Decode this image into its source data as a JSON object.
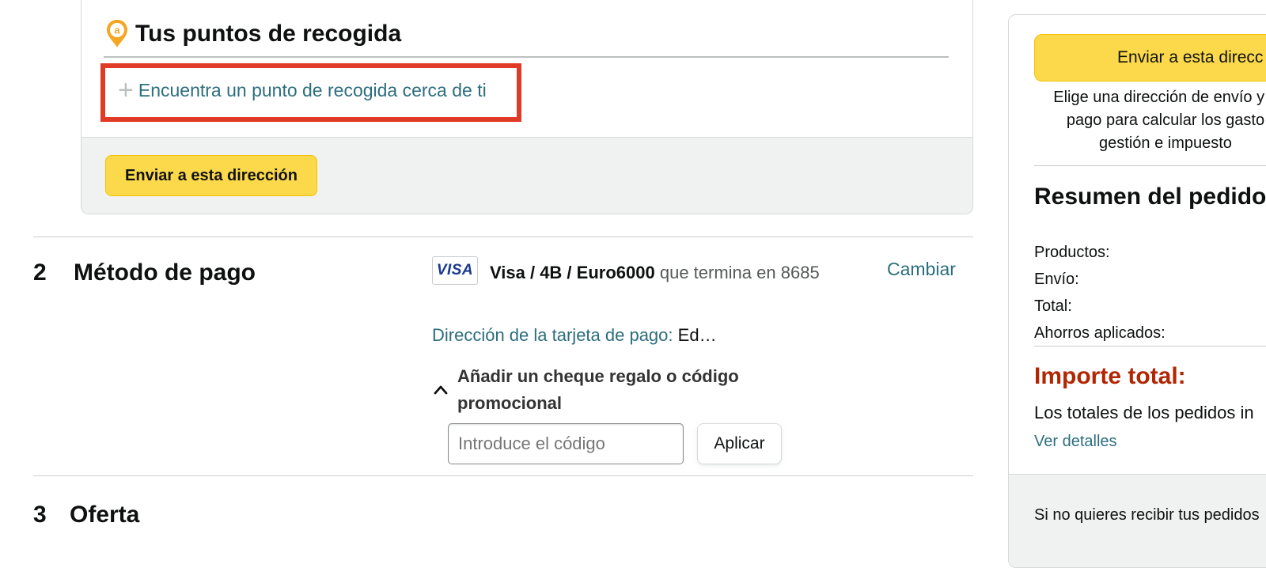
{
  "pickup": {
    "title": "Tus puntos de recogida",
    "find_link": "Encuentra un punto de recogida cerca de ti",
    "ship_button": "Enviar a esta dirección"
  },
  "payment": {
    "step_number": "2",
    "step_title": "Método de pago",
    "card_brand": "VISA",
    "card_name": "Visa / 4B / Euro6000",
    "card_suffix_text": "que termina en",
    "card_last4": "8685",
    "change_link": "Cambiar",
    "billing_label": "Dirección de la tarjeta de pago:",
    "billing_value": "Ed…",
    "gift_heading": "Añadir un cheque regalo o código promocional",
    "code_placeholder": "Introduce el código",
    "apply_button": "Aplicar"
  },
  "offer": {
    "step_number": "3",
    "step_title": "Oferta"
  },
  "summary": {
    "ship_button": "Enviar a esta direcc",
    "note_lines": [
      "Elige una dirección de envío y u",
      "pago para calcular los gasto",
      "gestión e impuesto"
    ],
    "title": "Resumen del pedido",
    "rows": [
      "Productos:",
      "Envío:",
      "Total:",
      "Ahorros aplicados:"
    ],
    "total_label": "Importe total:",
    "totals_note": "Los totales de los pedidos in",
    "details_link": "Ver detalles",
    "footer_text": "Si no quieres recibir tus pedidos"
  },
  "colors": {
    "accent_yellow": "#fcd94a",
    "link_teal": "#2c6e7e",
    "total_red": "#b12704",
    "highlight_red": "#e03b26"
  }
}
